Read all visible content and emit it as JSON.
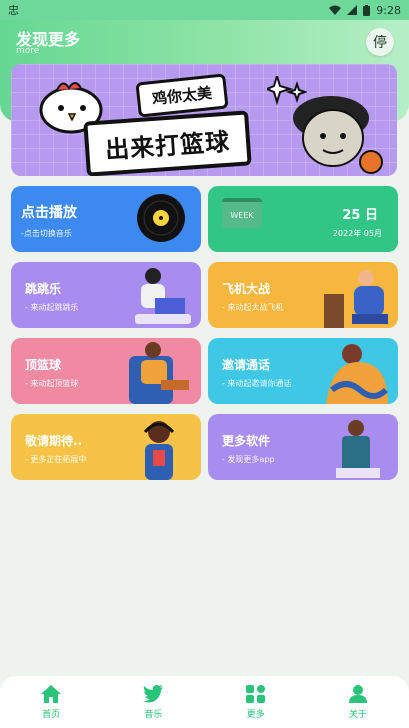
{
  "status_bar": {
    "left_glyph": "忠",
    "time": "9:28"
  },
  "header": {
    "title": "发现更多",
    "subtitle": "more",
    "stop_label": "停"
  },
  "banner": {
    "top_text": "鸡你太美",
    "main_text": "出来打篮球"
  },
  "cards": [
    {
      "title": "点击播放",
      "subtitle": "-点击切换音乐",
      "color": "#3c8af0"
    },
    {
      "week": "WEEK",
      "day": "25 日",
      "month": "2022年 05月",
      "color": "#31c586"
    },
    {
      "title": "跳跳乐",
      "subtitle": "- 来动起跳跳乐",
      "color": "#a98cf0"
    },
    {
      "title": "飞机大战",
      "subtitle": "- 来动起大战飞机",
      "color": "#f7b63d"
    },
    {
      "title": "顶篮球",
      "subtitle": "- 来动起顶篮球",
      "color": "#f08aa3"
    },
    {
      "title": "邀请通话",
      "subtitle": "- 来动起邀请你通话",
      "color": "#3fc7e6"
    },
    {
      "title": "敬请期待..",
      "subtitle": "- 更多正在拓展中",
      "color": "#f7c347"
    },
    {
      "title": "更多软件",
      "subtitle": "- 发现更多app",
      "color": "#a98cf0"
    }
  ],
  "tabs": [
    {
      "label": "首页",
      "icon": "home-icon"
    },
    {
      "label": "音乐",
      "icon": "twitter-bird-icon"
    },
    {
      "label": "更多",
      "icon": "apps-icon"
    },
    {
      "label": "关于",
      "icon": "user-icon"
    }
  ],
  "colors": {
    "accent": "#29c37a",
    "header": "#65d792"
  }
}
